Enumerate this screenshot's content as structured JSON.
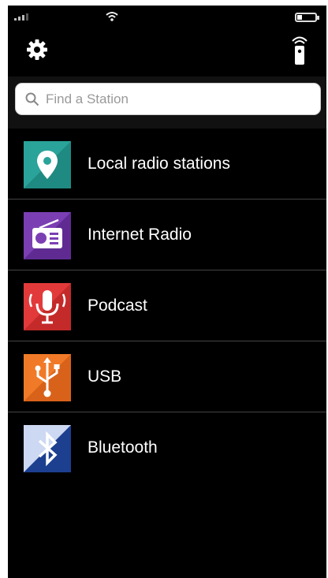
{
  "search": {
    "placeholder": "Find a Station"
  },
  "sources": [
    {
      "label": "Local radio stations",
      "icon": "location-pin-icon",
      "color": "#2aa39a"
    },
    {
      "label": "Internet Radio",
      "icon": "radio-icon",
      "color": "#7b3fb3"
    },
    {
      "label": "Podcast",
      "icon": "microphone-icon",
      "color": "#e23a3a"
    },
    {
      "label": "USB",
      "icon": "usb-icon",
      "color": "#f07a28"
    },
    {
      "label": "Bluetooth",
      "icon": "bluetooth-icon",
      "color": "#1c3f8f"
    }
  ]
}
